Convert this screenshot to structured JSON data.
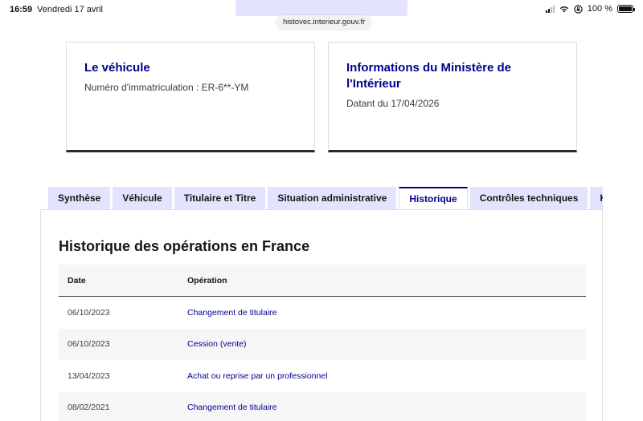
{
  "status_bar": {
    "time": "16:59",
    "date": "Vendredi 17 avril",
    "battery": "100 %",
    "battery_level": 1.0
  },
  "browser": {
    "url": "histovec.interieur.gouv.fr"
  },
  "cards": {
    "vehicle": {
      "title": "Le véhicule",
      "description": "Numéro d'immatriculation : ER-6**-YM"
    },
    "ministry": {
      "title": "Informations du Ministère de l'Intérieur",
      "description": "Datant du 17/04/2026"
    }
  },
  "tabs": [
    {
      "label": "Synthèse",
      "active": false
    },
    {
      "label": "Véhicule",
      "active": false
    },
    {
      "label": "Titulaire et Titre",
      "active": false
    },
    {
      "label": "Situation administrative",
      "active": false
    },
    {
      "label": "Historique",
      "active": true
    },
    {
      "label": "Contrôles techniques",
      "active": false
    },
    {
      "label": "Kilométrage",
      "active": false
    }
  ],
  "history": {
    "title": "Historique des opérations en France",
    "columns": {
      "date": "Date",
      "operation": "Opération"
    },
    "rows": [
      {
        "date": "06/10/2023",
        "operation": "Changement de titulaire"
      },
      {
        "date": "06/10/2023",
        "operation": "Cession (vente)"
      },
      {
        "date": "13/04/2023",
        "operation": "Achat ou reprise par un professionnel"
      },
      {
        "date": "08/02/2021",
        "operation": "Changement de titulaire"
      }
    ]
  },
  "colors": {
    "accent": "#000091",
    "tab_bg": "#e3e3fd",
    "row_alt": "#f6f6f6"
  }
}
